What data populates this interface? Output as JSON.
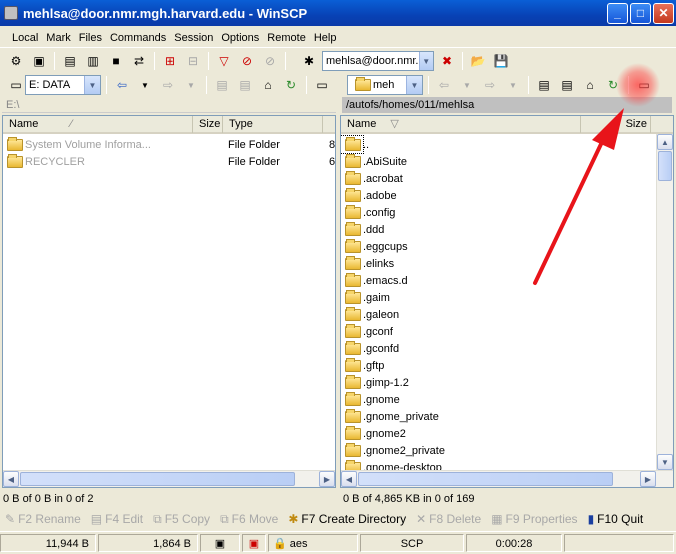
{
  "window": {
    "title": "mehlsa@door.nmr.mgh.harvard.edu - WinSCP"
  },
  "menu": [
    "Local",
    "Mark",
    "Files",
    "Commands",
    "Session",
    "Options",
    "Remote",
    "Help"
  ],
  "toolbar": {
    "session_combo": "mehlsa@door.nmr."
  },
  "left": {
    "drive_combo": "E: DATA",
    "path": "E:\\",
    "columns": {
      "name": "Name",
      "size": "Size",
      "type": "Type"
    },
    "rows": [
      {
        "name": "System Volume Informa...",
        "type": "File Folder",
        "extra": "8"
      },
      {
        "name": "RECYCLER",
        "type": "File Folder",
        "extra": "6"
      }
    ],
    "status": "0 B of 0 B in 0 of 2"
  },
  "right": {
    "dir_combo": "meh",
    "path": "/autofs/homes/011/mehlsa",
    "columns": {
      "name": "Name",
      "size": "Size"
    },
    "rows": [
      "..",
      ".AbiSuite",
      ".acrobat",
      ".adobe",
      ".config",
      ".ddd",
      ".eggcups",
      ".elinks",
      ".emacs.d",
      ".gaim",
      ".galeon",
      ".gconf",
      ".gconfd",
      ".gftp",
      ".gimp-1.2",
      ".gnome",
      ".gnome_private",
      ".gnome2",
      ".gnome2_private",
      ".gnome-desktop"
    ],
    "status": "0 B of 4,865 KB in 0 of 169"
  },
  "fkeys": [
    {
      "label": "F2 Rename",
      "icon": "rename-icon",
      "enabled": false
    },
    {
      "label": "F4 Edit",
      "icon": "edit-icon",
      "enabled": false
    },
    {
      "label": "F5 Copy",
      "icon": "copy-icon",
      "enabled": false
    },
    {
      "label": "F6 Move",
      "icon": "move-icon",
      "enabled": false
    },
    {
      "label": "F7 Create Directory",
      "icon": "create-directory-icon",
      "enabled": true
    },
    {
      "label": "F8 Delete",
      "icon": "delete-icon",
      "enabled": false
    },
    {
      "label": "F9 Properties",
      "icon": "properties-icon",
      "enabled": false
    },
    {
      "label": "F10 Quit",
      "icon": "quit-icon",
      "enabled": true
    }
  ],
  "statusbar": {
    "sent": "11,944 B",
    "received": "1,864 B",
    "cipher": "aes",
    "protocol": "SCP",
    "elapsed": "0:00:28"
  },
  "annotation": {
    "arrow_color": "#e8141a",
    "highlight_color": "#ff3b3b"
  }
}
